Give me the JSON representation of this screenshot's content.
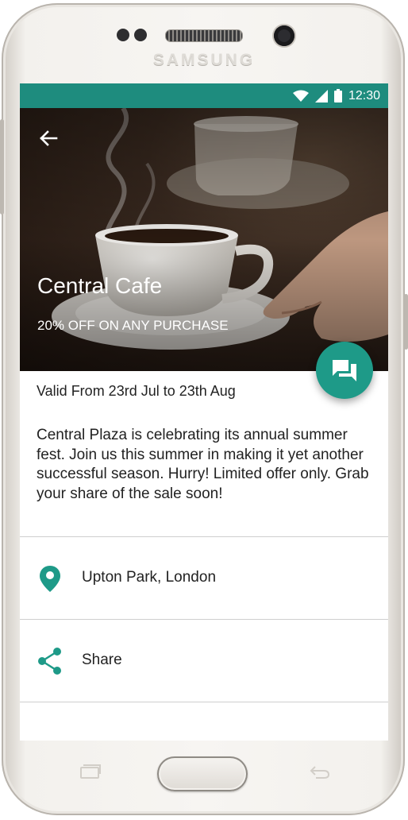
{
  "device": {
    "brand": "SAMSUNG"
  },
  "status_bar": {
    "time": "12:30",
    "color": "#1e8c7e",
    "icons": [
      "wifi-icon",
      "signal-icon",
      "battery-icon"
    ]
  },
  "hero": {
    "title": "Central Cafe",
    "subtitle": "20% OFF ON ANY PURCHASE",
    "back_icon": "arrow-back-icon",
    "fab_icon": "chat-icon"
  },
  "offer": {
    "validity": "Valid From 23rd Jul to 23th Aug",
    "description": "Central Plaza is celebrating its annual summer fest. Join us this summer in making it yet another successful season. Hurry! Limited offer only. Grab your share of the sale soon!"
  },
  "rows": [
    {
      "icon": "location-pin-icon",
      "label": "Upton Park, London"
    },
    {
      "icon": "share-icon",
      "label": "Share"
    }
  ],
  "accent": "#1e9a88"
}
